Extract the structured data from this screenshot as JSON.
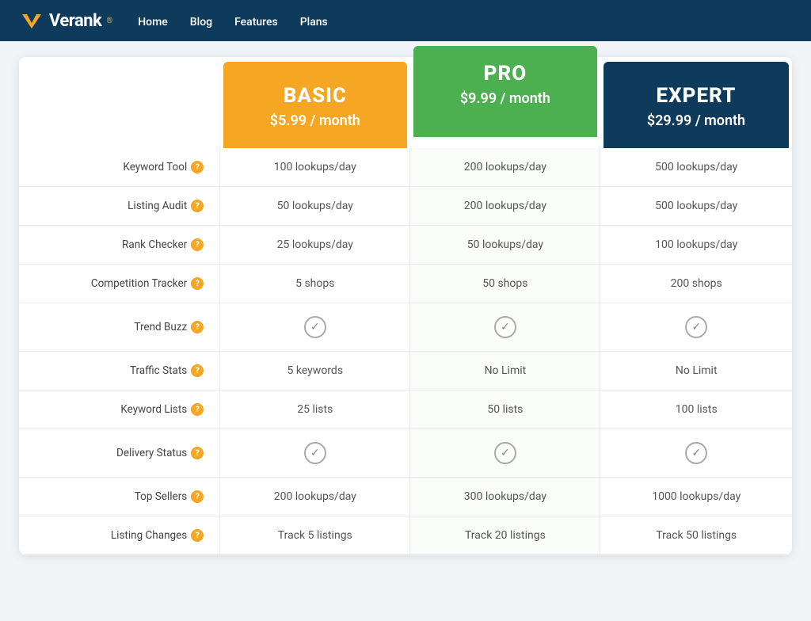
{
  "nav": {
    "brand": "Verank",
    "links": [
      "Home",
      "Blog",
      "Features",
      "Plans"
    ]
  },
  "plans": [
    {
      "id": "basic",
      "name": "BASIC",
      "price": "$5.99 / month"
    },
    {
      "id": "pro",
      "name": "PRO",
      "price": "$9.99 / month"
    },
    {
      "id": "expert",
      "name": "EXPERT",
      "price": "$29.99 / month"
    }
  ],
  "features": [
    {
      "label": "Keyword Tool",
      "basic": "100 lookups/day",
      "pro": "200 lookups/day",
      "expert": "500 lookups/day",
      "type": "text"
    },
    {
      "label": "Listing Audit",
      "basic": "50 lookups/day",
      "pro": "200 lookups/day",
      "expert": "500 lookups/day",
      "type": "text"
    },
    {
      "label": "Rank Checker",
      "basic": "25 lookups/day",
      "pro": "50 lookups/day",
      "expert": "100 lookups/day",
      "type": "text"
    },
    {
      "label": "Competition Tracker",
      "basic": "5 shops",
      "pro": "50 shops",
      "expert": "200 shops",
      "type": "text"
    },
    {
      "label": "Trend Buzz",
      "basic": "check",
      "pro": "check",
      "expert": "check",
      "type": "check"
    },
    {
      "label": "Traffic Stats",
      "basic": "5 keywords",
      "pro": "No Limit",
      "expert": "No Limit",
      "type": "text"
    },
    {
      "label": "Keyword Lists",
      "basic": "25 lists",
      "pro": "50 lists",
      "expert": "100 lists",
      "type": "text"
    },
    {
      "label": "Delivery Status",
      "basic": "check",
      "pro": "check",
      "expert": "check",
      "type": "check"
    },
    {
      "label": "Top Sellers",
      "basic": "200 lookups/day",
      "pro": "300 lookups/day",
      "expert": "1000 lookups/day",
      "type": "text"
    },
    {
      "label": "Listing Changes",
      "basic": "Track 5 listings",
      "pro": "Track 20 listings",
      "expert": "Track 50 listings",
      "type": "text"
    }
  ],
  "icons": {
    "question_mark": "?",
    "check_mark": "✓"
  }
}
